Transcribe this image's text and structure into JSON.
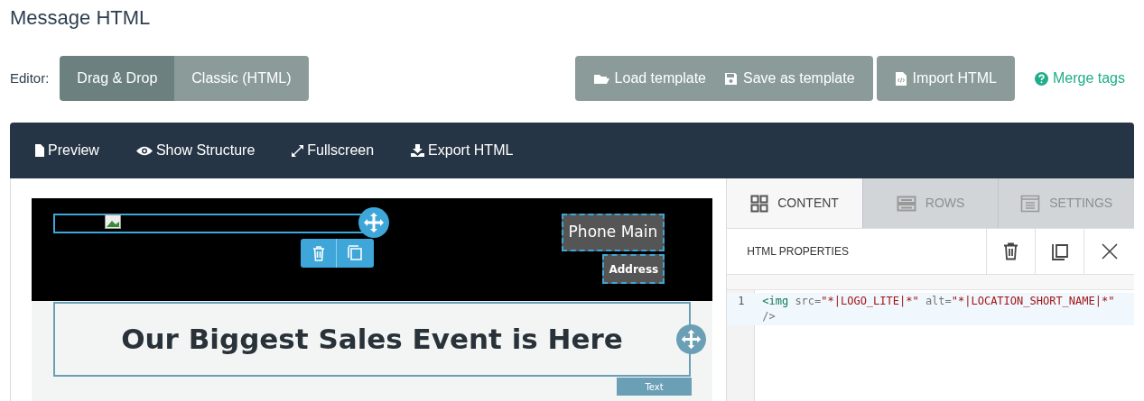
{
  "page_title": "Message HTML",
  "editor": {
    "label": "Editor:",
    "modes": [
      {
        "label": "Drag & Drop",
        "selected": true
      },
      {
        "label": "Classic (HTML)",
        "selected": false
      }
    ]
  },
  "template_buttons": [
    {
      "label": "Load template",
      "kind": "folder"
    },
    {
      "label": "Save as template",
      "kind": "floppy"
    }
  ],
  "import_button": {
    "label": "Import HTML",
    "kind": "file-code"
  },
  "merge_tags_link": "Merge tags",
  "toolbar": [
    {
      "label": "Preview",
      "kind": "file"
    },
    {
      "label": "Show Structure",
      "kind": "eye"
    },
    {
      "label": "Fullscreen",
      "kind": "expand"
    },
    {
      "label": "Export HTML",
      "kind": "download"
    }
  ],
  "canvas": {
    "phone_label": "Phone Main",
    "address_label": "Address",
    "headline": "Our Biggest Sales Event is Here",
    "block_type_label": "Text"
  },
  "panel": {
    "tabs": [
      {
        "label": "CONTENT",
        "kind": "grid",
        "selected": true
      },
      {
        "label": "ROWS",
        "kind": "rows",
        "selected": false
      },
      {
        "label": "SETTINGS",
        "kind": "doc",
        "selected": false
      }
    ],
    "properties_title": "HTML PROPERTIES",
    "code_lines": [
      {
        "number": "1",
        "tokens": [
          {
            "kind": "tag",
            "text": "<img"
          },
          {
            "kind": "attr",
            "text": " src="
          },
          {
            "kind": "string",
            "text": "\"*|LOGO_LITE|*\""
          },
          {
            "kind": "attr",
            "text": " alt="
          },
          {
            "kind": "string",
            "text": "\"*|LOCATION_SHORT_NAME|*\""
          },
          {
            "kind": "attr",
            "text": " />"
          }
        ]
      }
    ]
  }
}
